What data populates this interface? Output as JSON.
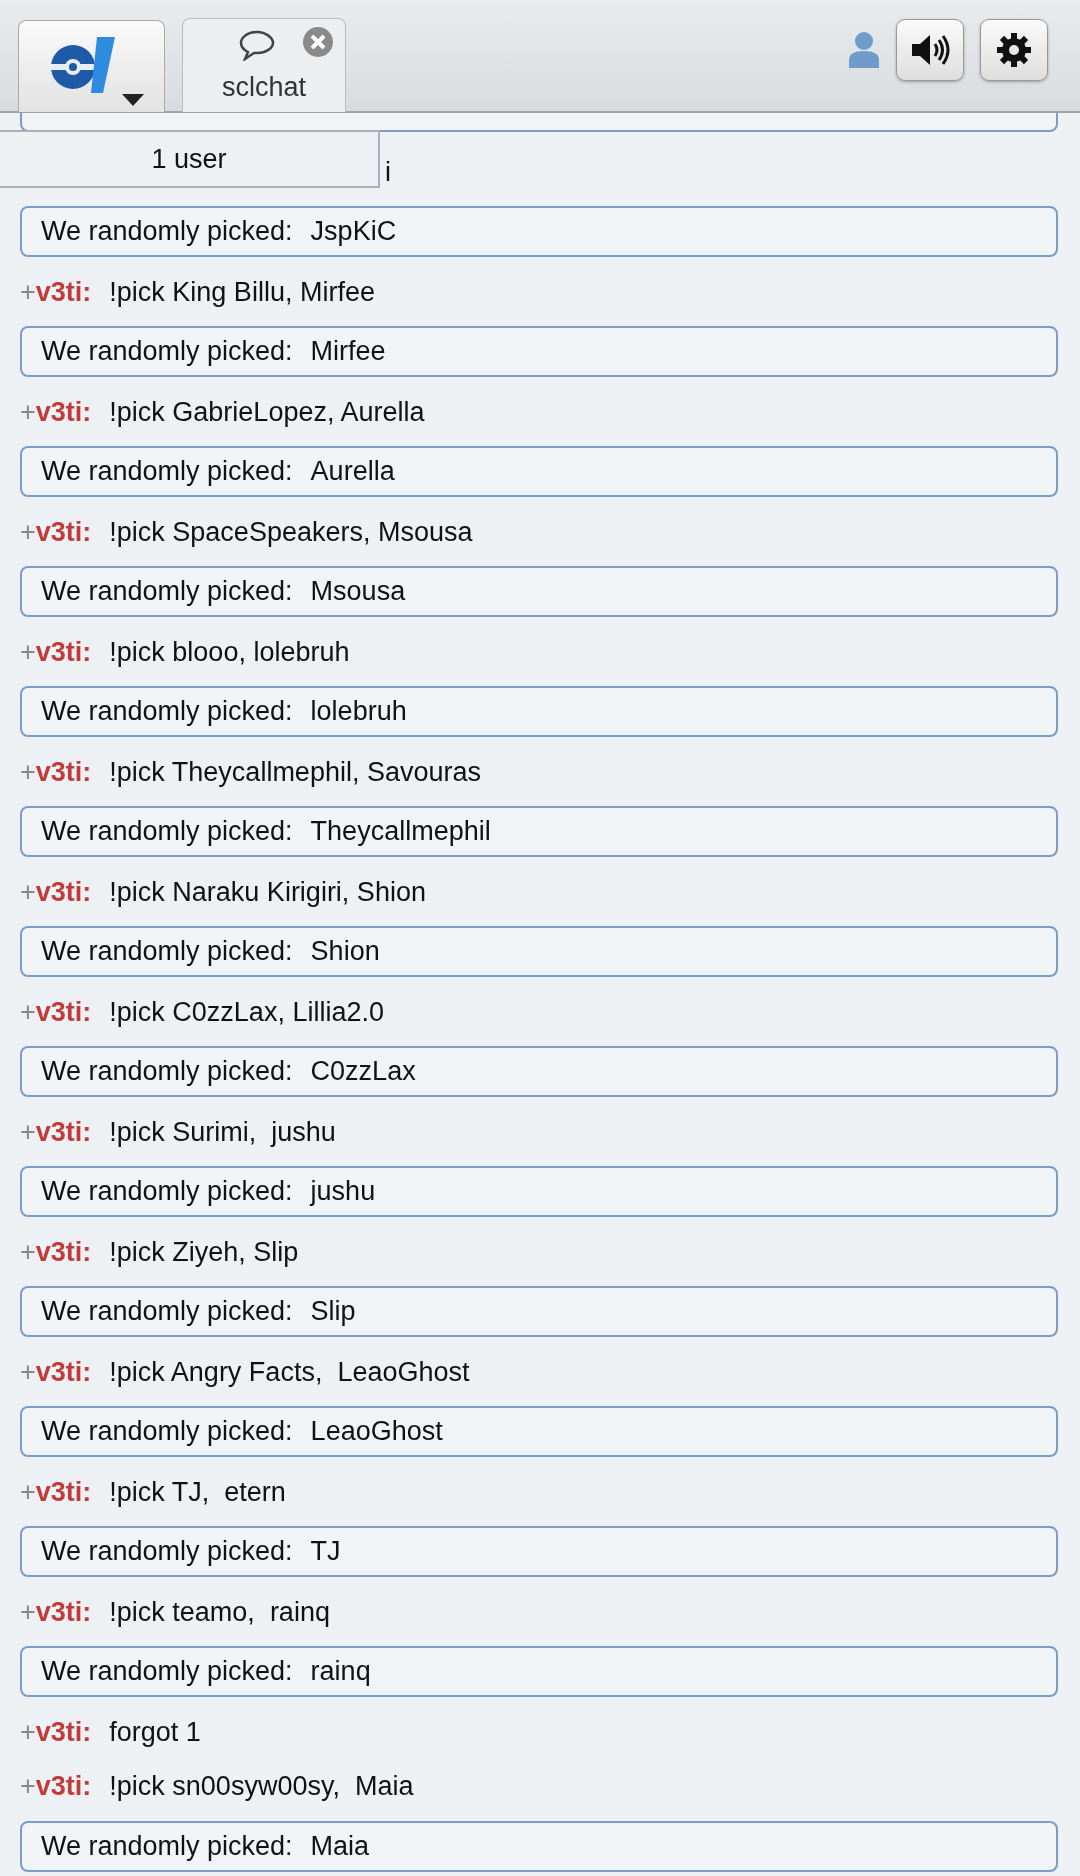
{
  "header": {
    "main_menu": {
      "kind": "logo"
    },
    "tabs": [
      {
        "label": "sclchat",
        "selected": true,
        "closable": true
      }
    ],
    "user_button": {
      "kind": "user"
    },
    "sound_button": {
      "kind": "sound"
    },
    "settings_button": {
      "kind": "settings"
    }
  },
  "user_list": {
    "count": "1 user"
  },
  "messages": [
    {
      "kind": "cut_box"
    },
    {
      "kind": "partial",
      "text": "i"
    },
    {
      "kind": "result",
      "label": "We randomly picked:",
      "value": "JspKiC"
    },
    {
      "kind": "chat",
      "rank": "+",
      "user": "v3ti:",
      "text": "!pick King Billu, Mirfee"
    },
    {
      "kind": "result",
      "label": "We randomly picked:",
      "value": "Mirfee"
    },
    {
      "kind": "chat",
      "rank": "+",
      "user": "v3ti:",
      "text": "!pick GabrieLopez, Aurella"
    },
    {
      "kind": "result",
      "label": "We randomly picked:",
      "value": "Aurella"
    },
    {
      "kind": "chat",
      "rank": "+",
      "user": "v3ti:",
      "text": "!pick SpaceSpeakers, Msousa"
    },
    {
      "kind": "result",
      "label": "We randomly picked:",
      "value": "Msousa"
    },
    {
      "kind": "chat",
      "rank": "+",
      "user": "v3ti:",
      "text": "!pick blooo, lolebruh"
    },
    {
      "kind": "result",
      "label": "We randomly picked:",
      "value": "lolebruh"
    },
    {
      "kind": "chat",
      "rank": "+",
      "user": "v3ti:",
      "text": "!pick Theycallmephil, Savouras"
    },
    {
      "kind": "result",
      "label": "We randomly picked:",
      "value": "Theycallmephil"
    },
    {
      "kind": "chat",
      "rank": "+",
      "user": "v3ti:",
      "text": "!pick Naraku Kirigiri, Shion"
    },
    {
      "kind": "result",
      "label": "We randomly picked:",
      "value": "Shion"
    },
    {
      "kind": "chat",
      "rank": "+",
      "user": "v3ti:",
      "text": "!pick C0zzLax, Lillia2.0"
    },
    {
      "kind": "result",
      "label": "We randomly picked:",
      "value": "C0zzLax"
    },
    {
      "kind": "chat",
      "rank": "+",
      "user": "v3ti:",
      "text": "!pick Surimi,  jushu"
    },
    {
      "kind": "result",
      "label": "We randomly picked:",
      "value": "jushu"
    },
    {
      "kind": "chat",
      "rank": "+",
      "user": "v3ti:",
      "text": "!pick Ziyeh, Slip"
    },
    {
      "kind": "result",
      "label": "We randomly picked:",
      "value": "Slip"
    },
    {
      "kind": "chat",
      "rank": "+",
      "user": "v3ti:",
      "text": "!pick Angry Facts,  LeaoGhost"
    },
    {
      "kind": "result",
      "label": "We randomly picked:",
      "value": "LeaoGhost"
    },
    {
      "kind": "chat",
      "rank": "+",
      "user": "v3ti:",
      "text": "!pick TJ,  etern"
    },
    {
      "kind": "result",
      "label": "We randomly picked:",
      "value": "TJ"
    },
    {
      "kind": "chat",
      "rank": "+",
      "user": "v3ti:",
      "text": "!pick teamo,  rainq"
    },
    {
      "kind": "result",
      "label": "We randomly picked:",
      "value": "rainq"
    },
    {
      "kind": "chat",
      "rank": "+",
      "user": "v3ti:",
      "text": "forgot 1"
    },
    {
      "kind": "chat",
      "rank": "+",
      "user": "v3ti:",
      "text": "!pick sn00syw00sy,  Maia"
    },
    {
      "kind": "result",
      "label": "We randomly picked:",
      "value": "Maia"
    }
  ]
}
